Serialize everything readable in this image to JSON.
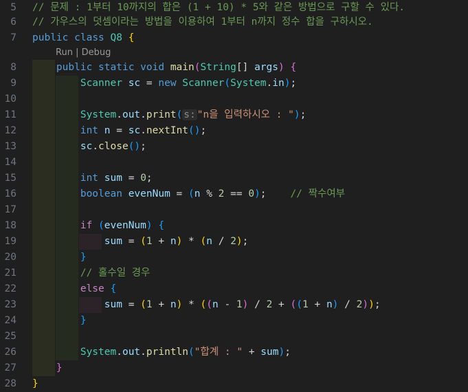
{
  "editor": {
    "codelens": {
      "run": "Run",
      "separator": " | ",
      "debug": "Debug"
    },
    "line_numbers": [
      "5",
      "6",
      "7",
      "8",
      "9",
      "10",
      "11",
      "12",
      "13",
      "14",
      "15",
      "16",
      "17",
      "18",
      "19",
      "20",
      "21",
      "22",
      "23",
      "24",
      "25",
      "26",
      "27",
      "28"
    ],
    "lines": {
      "l5": "// 문제 : 1부터 10까지의 합은 (1 + 10) * 5와 같은 방법으로 구할 수 있다.",
      "l6": "// 가우스의 덧셈이라는 방법을 이용하여 1부터 n까지 정수 합을 구하시오.",
      "l7_kw1": "public",
      "l7_kw2": "class",
      "l7_name": "Q8",
      "l7_brace": "{",
      "l8_kw1": "public",
      "l8_kw2": "static",
      "l8_kw3": "void",
      "l8_fn": "main",
      "l8_type": "String",
      "l8_arr": "[]",
      "l8_var": "args",
      "l9_type": "Scanner",
      "l9_var": "sc",
      "l9_new": "new",
      "l9_type2": "Scanner",
      "l9_sys": "System",
      "l9_in": "in",
      "l11_sys": "System",
      "l11_out": "out",
      "l11_fn": "print",
      "l11_hint": "s:",
      "l11_str": "\"n을 입력하시오 : \"",
      "l12_kw": "int",
      "l12_var": "n",
      "l12_sc": "sc",
      "l12_fn": "nextInt",
      "l13_sc": "sc",
      "l13_fn": "close",
      "l15_kw": "int",
      "l15_var": "sum",
      "l15_num": "0",
      "l16_kw": "boolean",
      "l16_var": "evenNum",
      "l16_n": "n",
      "l16_num1": "2",
      "l16_num2": "0",
      "l16_com": "// 짝수여부",
      "l18_kw": "if",
      "l18_var": "evenNum",
      "l19_sum": "sum",
      "l19_n1": "1",
      "l19_n": "n",
      "l19_n2": "n",
      "l19_num": "2",
      "l21_com": "// 홀수일 경우",
      "l22_kw": "else",
      "l23_sum": "sum",
      "l23_a": "1",
      "l23_n1": "n",
      "l23_n2": "n",
      "l23_b": "1",
      "l23_c": "2",
      "l23_d": "1",
      "l23_n3": "n",
      "l23_e": "2",
      "l26_sys": "System",
      "l26_out": "out",
      "l26_fn": "println",
      "l26_str": "\"합계 : \"",
      "l26_var": "sum"
    }
  },
  "colors": {
    "background": "#1f1f1f",
    "keyword": "#569cd6",
    "type": "#4ec9b0",
    "function": "#dcdcaa",
    "variable": "#9cdcfe",
    "number": "#b5cea8",
    "string": "#ce9178",
    "comment": "#6a9955",
    "control": "#c586c0"
  }
}
